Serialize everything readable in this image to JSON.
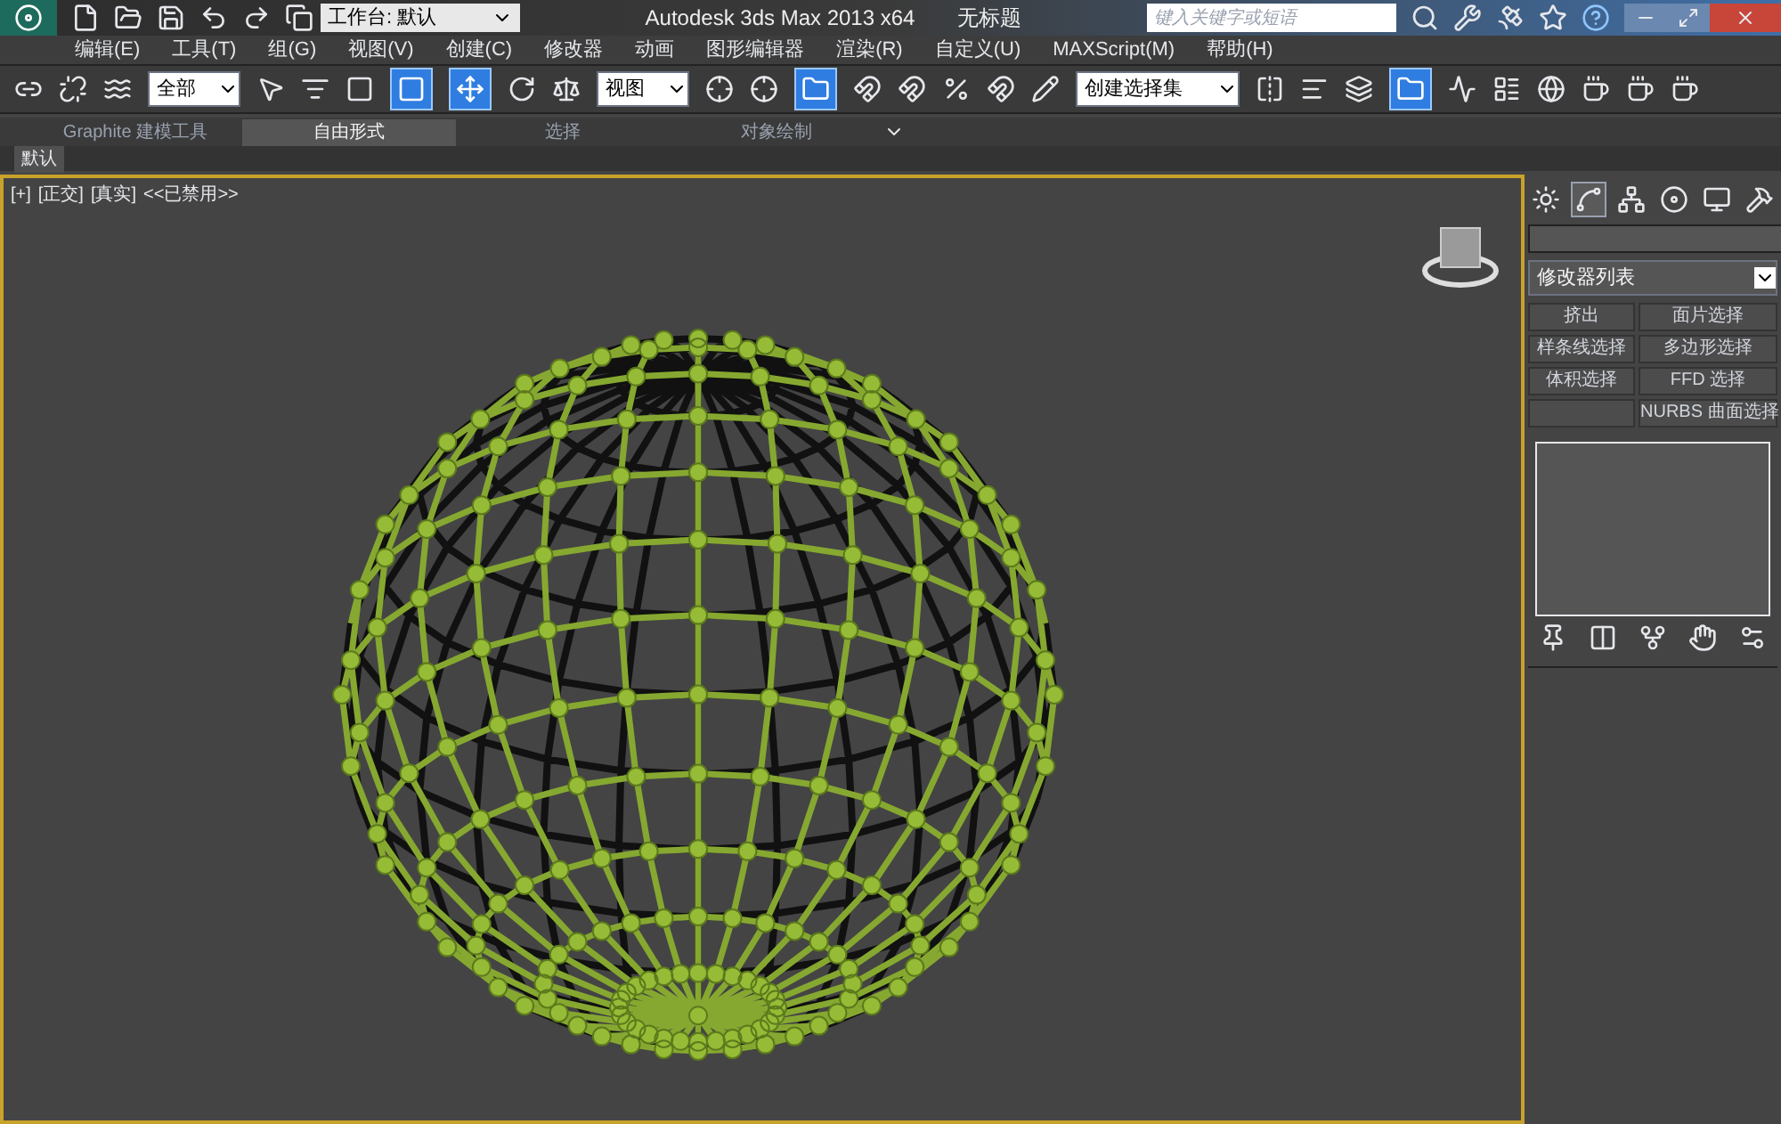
{
  "title_bar": {
    "workspace": "工作台: 默认",
    "app_title": "Autodesk 3ds Max  2013 x64",
    "document": "无标题",
    "search": {
      "placeholder": "键入关键字或短语"
    }
  },
  "menu": [
    "编辑(E)",
    "工具(T)",
    "组(G)",
    "视图(V)",
    "创建(C)",
    "修改器",
    "动画",
    "图形编辑器",
    "渲染(R)",
    "自定义(U)",
    "MAXScript(M)",
    "帮助(H)"
  ],
  "toolbar": {
    "selection_filter": "全部",
    "reference_coord": "视图",
    "selection_set": "创建选择集"
  },
  "ribbon": {
    "tabs": [
      {
        "label": "Graphite 建模工具",
        "selected": false
      },
      {
        "label": "自由形式",
        "selected": true
      },
      {
        "label": "选择",
        "selected": false
      },
      {
        "label": "对象绘制",
        "selected": false
      }
    ],
    "panel": "默认"
  },
  "viewport": {
    "labels": [
      "[+]",
      "[正交]",
      "[真实]",
      "<<已禁用>>"
    ]
  },
  "command_panel": {
    "tabs": [
      {
        "selected": false
      },
      {
        "selected": true
      },
      {
        "selected": false
      },
      {
        "selected": false
      },
      {
        "selected": false
      },
      {
        "selected": false
      }
    ],
    "modifier_list": "修改器列表",
    "buttons": [
      {
        "kind": "label",
        "label": "挤出"
      },
      {
        "kind": "label",
        "label": "面片选择"
      },
      {
        "kind": "label",
        "label": "样条线选择"
      },
      {
        "kind": "label",
        "label": "多边形选择"
      },
      {
        "kind": "label",
        "label": "体积选择"
      },
      {
        "kind": "label",
        "label": "FFD 选择"
      },
      {
        "kind": "blank"
      },
      {
        "kind": "label",
        "label": "NURBS 曲面选择"
      }
    ]
  }
}
